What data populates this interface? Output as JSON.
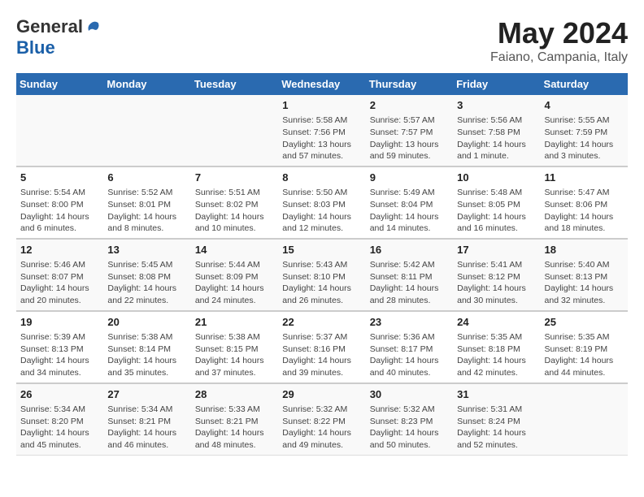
{
  "header": {
    "logo_general": "General",
    "logo_blue": "Blue",
    "title": "May 2024",
    "subtitle": "Faiano, Campania, Italy"
  },
  "columns": [
    "Sunday",
    "Monday",
    "Tuesday",
    "Wednesday",
    "Thursday",
    "Friday",
    "Saturday"
  ],
  "weeks": [
    {
      "days": [
        {
          "num": "",
          "info": ""
        },
        {
          "num": "",
          "info": ""
        },
        {
          "num": "",
          "info": ""
        },
        {
          "num": "1",
          "info": "Sunrise: 5:58 AM\nSunset: 7:56 PM\nDaylight: 13 hours\nand 57 minutes."
        },
        {
          "num": "2",
          "info": "Sunrise: 5:57 AM\nSunset: 7:57 PM\nDaylight: 13 hours\nand 59 minutes."
        },
        {
          "num": "3",
          "info": "Sunrise: 5:56 AM\nSunset: 7:58 PM\nDaylight: 14 hours\nand 1 minute."
        },
        {
          "num": "4",
          "info": "Sunrise: 5:55 AM\nSunset: 7:59 PM\nDaylight: 14 hours\nand 3 minutes."
        }
      ]
    },
    {
      "days": [
        {
          "num": "5",
          "info": "Sunrise: 5:54 AM\nSunset: 8:00 PM\nDaylight: 14 hours\nand 6 minutes."
        },
        {
          "num": "6",
          "info": "Sunrise: 5:52 AM\nSunset: 8:01 PM\nDaylight: 14 hours\nand 8 minutes."
        },
        {
          "num": "7",
          "info": "Sunrise: 5:51 AM\nSunset: 8:02 PM\nDaylight: 14 hours\nand 10 minutes."
        },
        {
          "num": "8",
          "info": "Sunrise: 5:50 AM\nSunset: 8:03 PM\nDaylight: 14 hours\nand 12 minutes."
        },
        {
          "num": "9",
          "info": "Sunrise: 5:49 AM\nSunset: 8:04 PM\nDaylight: 14 hours\nand 14 minutes."
        },
        {
          "num": "10",
          "info": "Sunrise: 5:48 AM\nSunset: 8:05 PM\nDaylight: 14 hours\nand 16 minutes."
        },
        {
          "num": "11",
          "info": "Sunrise: 5:47 AM\nSunset: 8:06 PM\nDaylight: 14 hours\nand 18 minutes."
        }
      ]
    },
    {
      "days": [
        {
          "num": "12",
          "info": "Sunrise: 5:46 AM\nSunset: 8:07 PM\nDaylight: 14 hours\nand 20 minutes."
        },
        {
          "num": "13",
          "info": "Sunrise: 5:45 AM\nSunset: 8:08 PM\nDaylight: 14 hours\nand 22 minutes."
        },
        {
          "num": "14",
          "info": "Sunrise: 5:44 AM\nSunset: 8:09 PM\nDaylight: 14 hours\nand 24 minutes."
        },
        {
          "num": "15",
          "info": "Sunrise: 5:43 AM\nSunset: 8:10 PM\nDaylight: 14 hours\nand 26 minutes."
        },
        {
          "num": "16",
          "info": "Sunrise: 5:42 AM\nSunset: 8:11 PM\nDaylight: 14 hours\nand 28 minutes."
        },
        {
          "num": "17",
          "info": "Sunrise: 5:41 AM\nSunset: 8:12 PM\nDaylight: 14 hours\nand 30 minutes."
        },
        {
          "num": "18",
          "info": "Sunrise: 5:40 AM\nSunset: 8:13 PM\nDaylight: 14 hours\nand 32 minutes."
        }
      ]
    },
    {
      "days": [
        {
          "num": "19",
          "info": "Sunrise: 5:39 AM\nSunset: 8:13 PM\nDaylight: 14 hours\nand 34 minutes."
        },
        {
          "num": "20",
          "info": "Sunrise: 5:38 AM\nSunset: 8:14 PM\nDaylight: 14 hours\nand 35 minutes."
        },
        {
          "num": "21",
          "info": "Sunrise: 5:38 AM\nSunset: 8:15 PM\nDaylight: 14 hours\nand 37 minutes."
        },
        {
          "num": "22",
          "info": "Sunrise: 5:37 AM\nSunset: 8:16 PM\nDaylight: 14 hours\nand 39 minutes."
        },
        {
          "num": "23",
          "info": "Sunrise: 5:36 AM\nSunset: 8:17 PM\nDaylight: 14 hours\nand 40 minutes."
        },
        {
          "num": "24",
          "info": "Sunrise: 5:35 AM\nSunset: 8:18 PM\nDaylight: 14 hours\nand 42 minutes."
        },
        {
          "num": "25",
          "info": "Sunrise: 5:35 AM\nSunset: 8:19 PM\nDaylight: 14 hours\nand 44 minutes."
        }
      ]
    },
    {
      "days": [
        {
          "num": "26",
          "info": "Sunrise: 5:34 AM\nSunset: 8:20 PM\nDaylight: 14 hours\nand 45 minutes."
        },
        {
          "num": "27",
          "info": "Sunrise: 5:34 AM\nSunset: 8:21 PM\nDaylight: 14 hours\nand 46 minutes."
        },
        {
          "num": "28",
          "info": "Sunrise: 5:33 AM\nSunset: 8:21 PM\nDaylight: 14 hours\nand 48 minutes."
        },
        {
          "num": "29",
          "info": "Sunrise: 5:32 AM\nSunset: 8:22 PM\nDaylight: 14 hours\nand 49 minutes."
        },
        {
          "num": "30",
          "info": "Sunrise: 5:32 AM\nSunset: 8:23 PM\nDaylight: 14 hours\nand 50 minutes."
        },
        {
          "num": "31",
          "info": "Sunrise: 5:31 AM\nSunset: 8:24 PM\nDaylight: 14 hours\nand 52 minutes."
        },
        {
          "num": "",
          "info": ""
        }
      ]
    }
  ]
}
